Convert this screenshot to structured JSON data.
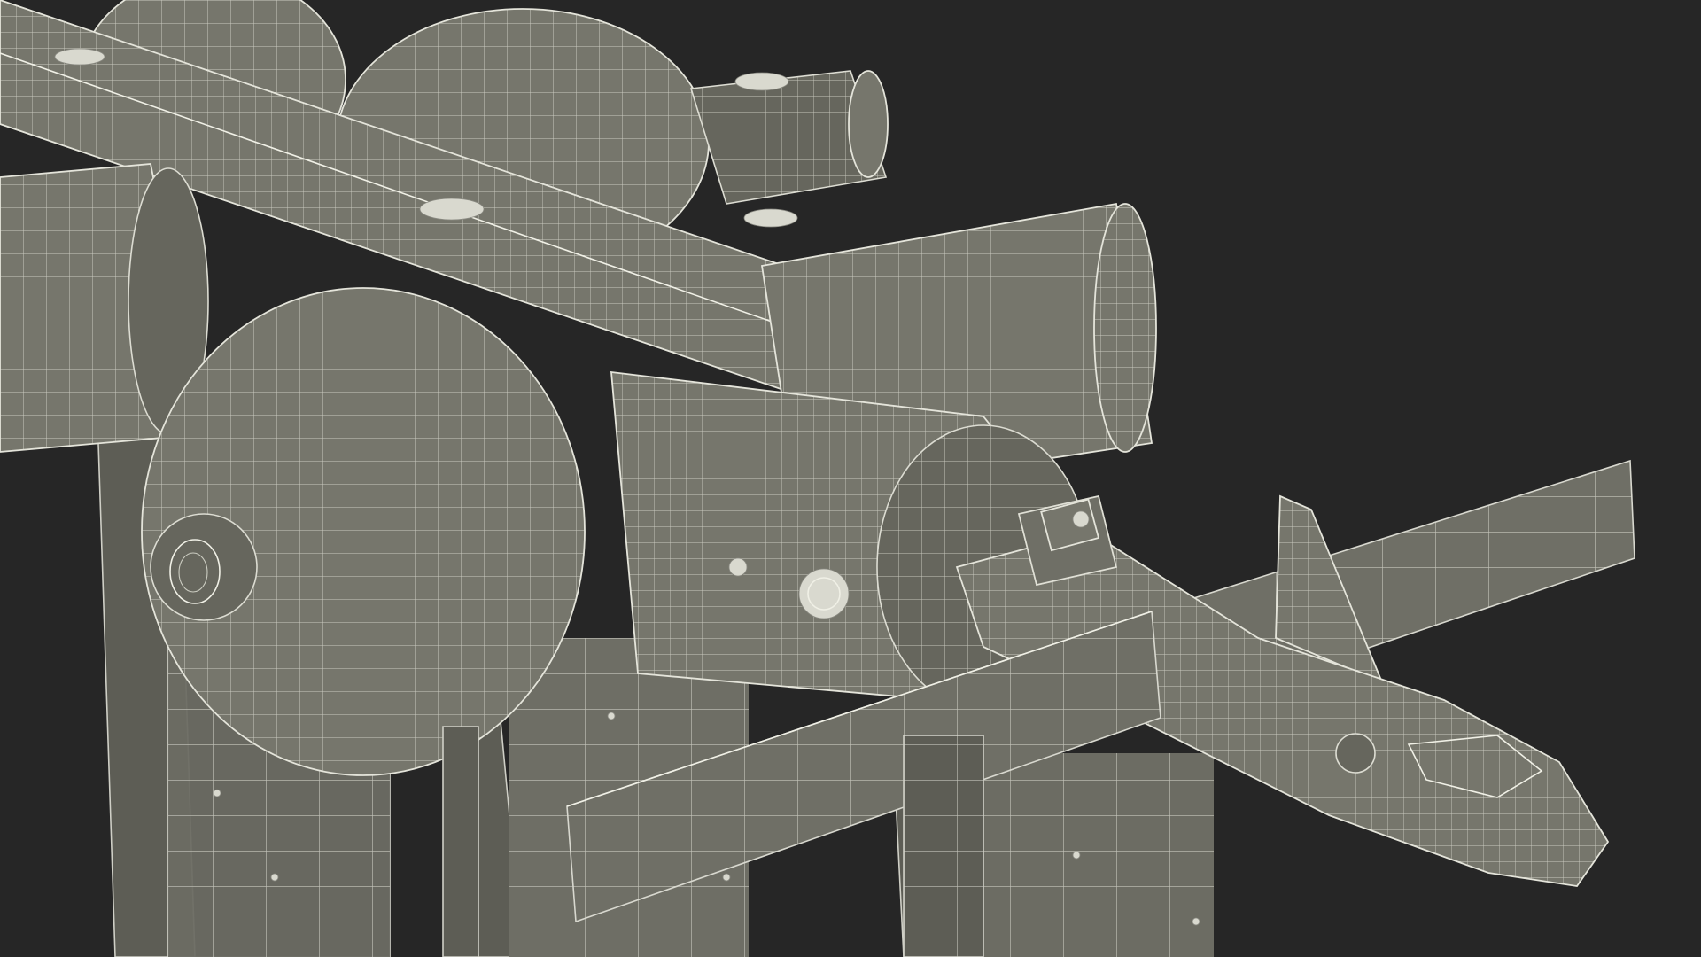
{
  "scene": {
    "description_kind": "3d-wireframe-render",
    "colors": {
      "background": "#262626",
      "model_fill": "#73736a",
      "model_fill_dark": "#5f5f57",
      "wire": "#e2e2d8"
    }
  }
}
